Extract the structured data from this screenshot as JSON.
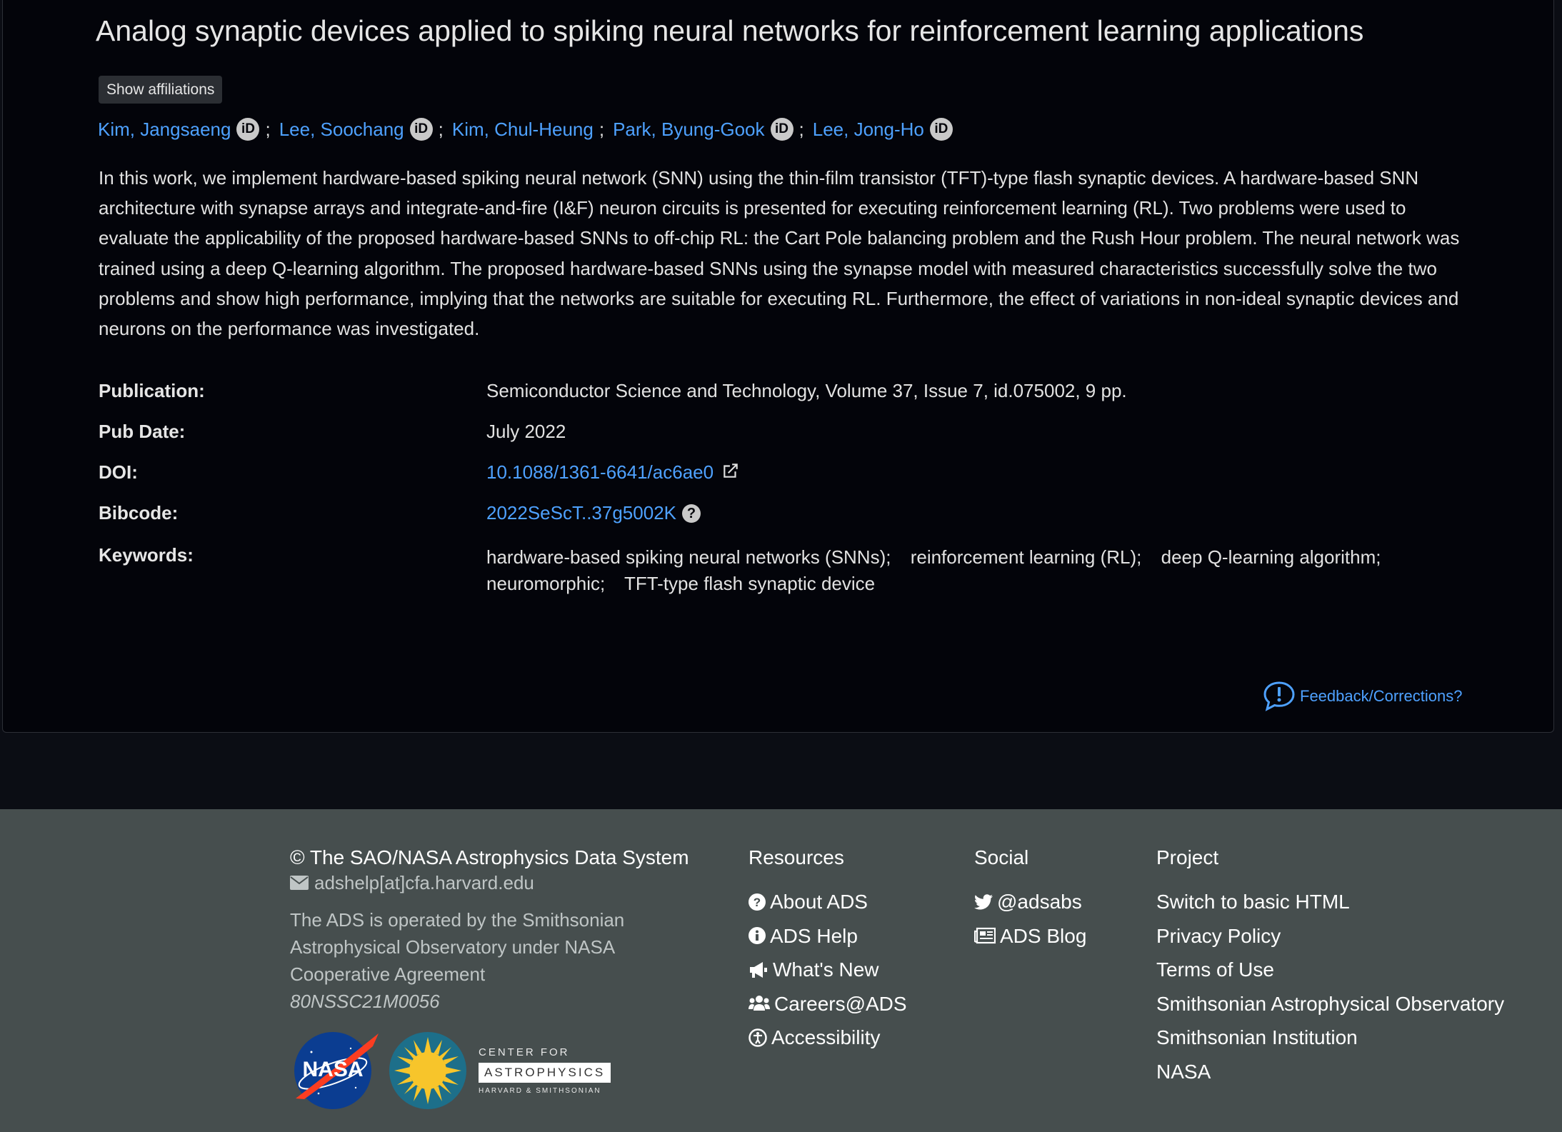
{
  "article": {
    "title": "Analog synaptic devices applied to spiking neural networks for reinforcement learning applications",
    "show_affiliations_label": "Show affiliations",
    "authors": [
      {
        "name": "Kim, Jangsaeng",
        "orcid": true
      },
      {
        "name": "Lee, Soochang",
        "orcid": true
      },
      {
        "name": "Kim, Chul-Heung",
        "orcid": false
      },
      {
        "name": "Park, Byung-Gook",
        "orcid": true
      },
      {
        "name": "Lee, Jong-Ho",
        "orcid": true
      }
    ],
    "author_separator": ";",
    "orcid_label": "iD",
    "abstract": "In this work, we implement hardware-based spiking neural network (SNN) using the thin-film transistor (TFT)-type flash synaptic devices. A hardware-based SNN architecture with synapse arrays and integrate-and-fire (I&F) neuron circuits is presented for executing reinforcement learning (RL). Two problems were used to evaluate the applicability of the proposed hardware-based SNNs to off-chip RL: the Cart Pole balancing problem and the Rush Hour problem. The neural network was trained using a deep Q-learning algorithm. The proposed hardware-based SNNs using the synapse model with measured characteristics successfully solve the two problems and show high performance, implying that the networks are suitable for executing RL. Furthermore, the effect of variations in non-ideal synaptic devices and neurons on the performance was investigated.",
    "metadata": {
      "publication_label": "Publication:",
      "publication": "Semiconductor Science and Technology, Volume 37, Issue 7, id.075002, 9 pp.",
      "pubdate_label": "Pub Date:",
      "pubdate": "July 2022",
      "doi_label": "DOI:",
      "doi": "10.1088/1361-6641/ac6ae0",
      "bibcode_label": "Bibcode:",
      "bibcode": "2022SeScT..37g5002K",
      "keywords_label": "Keywords:",
      "keywords": [
        "hardware-based spiking neural networks (SNNs);",
        "reinforcement learning (RL);",
        "deep Q-learning algorithm;",
        "neuromorphic;",
        "TFT-type flash synaptic device"
      ]
    },
    "feedback_label": "Feedback/Corrections?"
  },
  "footer": {
    "brand": "© The SAO/NASA Astrophysics Data System",
    "email": "adshelp[at]cfa.harvard.edu",
    "operated_by": "The ADS is operated by the Smithsonian Astrophysical Observatory under NASA Cooperative Agreement",
    "agreement_number": "80NSSC21M0056",
    "nasa_logo_text": "NASA",
    "cfa_logo": {
      "top": "CENTER FOR",
      "middle": "ASTROPHYSICS",
      "bottom": "HARVARD & SMITHSONIAN"
    },
    "resources": {
      "heading": "Resources",
      "items": [
        {
          "label": "About ADS",
          "icon": "question-circle-icon"
        },
        {
          "label": "ADS Help",
          "icon": "info-circle-icon"
        },
        {
          "label": "What's New",
          "icon": "bullhorn-icon"
        },
        {
          "label": "Careers@ADS",
          "icon": "users-icon"
        },
        {
          "label": "Accessibility",
          "icon": "accessibility-icon"
        }
      ]
    },
    "social": {
      "heading": "Social",
      "items": [
        {
          "label": "@adsabs",
          "icon": "twitter-icon"
        },
        {
          "label": "ADS Blog",
          "icon": "newspaper-icon"
        }
      ]
    },
    "project": {
      "heading": "Project",
      "items": [
        "Switch to basic HTML",
        "Privacy Policy",
        "Terms of Use",
        "Smithsonian Astrophysical Observatory",
        "Smithsonian Institution",
        "NASA"
      ]
    }
  },
  "colors": {
    "page_bg": "#03040a",
    "link": "#4ea1ff",
    "footer_bg": "#464e4e"
  }
}
